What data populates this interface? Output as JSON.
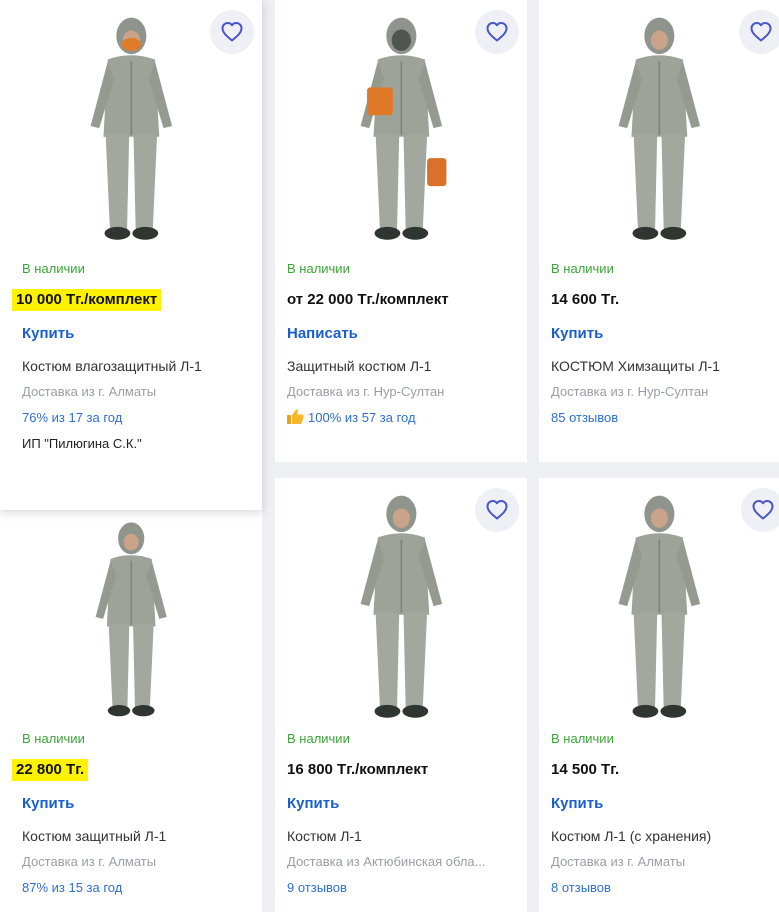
{
  "colors": {
    "availability": "#3aa637",
    "link": "#1a5fd0",
    "highlight": "#fff200",
    "muted": "#9a9ea6"
  },
  "icons": {
    "favorite": "heart-outline-icon",
    "thumb": "thumbs-up-icon"
  },
  "products": [
    {
      "availability": "В наличии",
      "price": "10 000 Тг./комплект",
      "price_highlighted": true,
      "action": "Купить",
      "title": "Костюм влагозащитный Л-1",
      "delivery": "Доставка из г. Алматы",
      "rating": "76% из 17 за год",
      "seller": "ИП \"Пилюгина С.К.\""
    },
    {
      "availability": "В наличии",
      "price": "от 22 000 Тг./комплект",
      "action": "Написать",
      "title": "Защитный костюм Л-1",
      "delivery": "Доставка из г. Нур-Султан",
      "rating": "100% из 57 за год"
    },
    {
      "availability": "В наличии",
      "price": "14 600 Тг.",
      "action": "Купить",
      "title": "КОСТЮМ Химзащиты Л-1",
      "delivery": "Доставка из г. Нур-Султан",
      "rating": "85 отзывов"
    },
    {
      "availability": "В наличии",
      "price": "22 800 Тг.",
      "price_highlighted": true,
      "action": "Купить",
      "title": "Костюм защитный Л-1",
      "delivery": "Доставка из г. Алматы",
      "rating": "87% из 15 за год"
    },
    {
      "availability": "В наличии",
      "price": "16 800 Тг./комплект",
      "action": "Купить",
      "title": "Костюм Л-1",
      "delivery": "Доставка из Актюбинская обла...",
      "rating": "9 отзывов"
    },
    {
      "availability": "В наличии",
      "price": "14 500 Тг.",
      "action": "Купить",
      "title": "Костюм Л-1 (с хранения)",
      "delivery": "Доставка из г. Алматы",
      "rating": "8 отзывов"
    }
  ]
}
